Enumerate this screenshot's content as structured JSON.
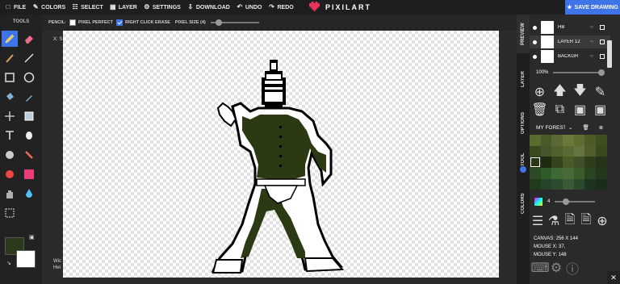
{
  "topbar": {
    "menu": [
      {
        "label": "FILE",
        "icon": "file-icon"
      },
      {
        "label": "COLORS",
        "icon": "brush-icon"
      },
      {
        "label": "SELECT",
        "icon": "select-icon"
      },
      {
        "label": "LAYER",
        "icon": "layer-icon"
      },
      {
        "label": "SETTINGS",
        "icon": "gear-icon"
      },
      {
        "label": "DOWNLOAD",
        "icon": "download-icon"
      },
      {
        "label": "UNDO",
        "icon": "undo-icon"
      },
      {
        "label": "REDO",
        "icon": "redo-icon"
      }
    ],
    "logo_text": "PIXILART",
    "save_label": "SAVE DRAWING"
  },
  "toolbar": {
    "title": "TOOLS",
    "primary_color": "#2b3a1a",
    "secondary_color": "#ffffff"
  },
  "options": {
    "tool_label": "PENCIL:",
    "pixel_perfect": "PIXEL PERFECT",
    "right_click_erase": "RIGHT CLICK ERASE",
    "pixel_size": "PIXEL SIZE (4)"
  },
  "canvas": {
    "x_label": "X: S",
    "width_label": "Wic",
    "height_label": "Hei"
  },
  "sidetabs": [
    "PREVIEW",
    "LAYER",
    "OPTIONS",
    "TOOL",
    "COLORS"
  ],
  "layers": [
    {
      "name": "HB"
    },
    {
      "name": "LAYER 12"
    },
    {
      "name": "BACKGR"
    }
  ],
  "zoom": "100%",
  "palette": {
    "name": "MY FOREST",
    "colors": [
      "#5a6b2e",
      "#4a5a28",
      "#5b6a34",
      "#6b7a3a",
      "#5e6d30",
      "#4d5c27",
      "#3f4e20",
      "#3b4a1e",
      "#46562a",
      "#52602e",
      "#5a6a34",
      "#667440",
      "#4f5e2c",
      "#3a4a1c",
      "#2a3618",
      "#1e2a12",
      "#34441c",
      "#4b5a2a",
      "#3f5028",
      "#2e3e1a",
      "#26341a",
      "#2c4a26",
      "#2f5a2a",
      "#3c6a32",
      "#486a36",
      "#3d5c2e",
      "#2a4422",
      "#22381c",
      "#223a1e",
      "#26442a",
      "#2e4a2e",
      "#3a5a36",
      "#2a4a2c",
      "#1e3420",
      "#1a2c1a"
    ],
    "size": "4"
  },
  "info": {
    "canvas": "CANVAS: 256 X 144",
    "mouse_x": "MOUSE X: 37,",
    "mouse_y": "MOUSE Y: 148"
  }
}
